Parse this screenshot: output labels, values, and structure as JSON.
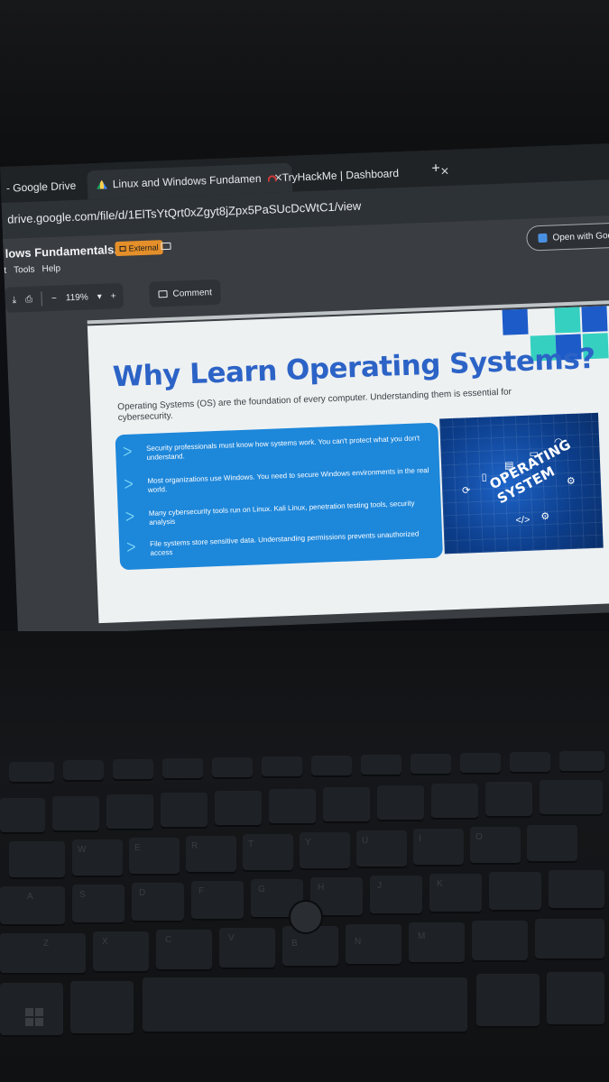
{
  "browser": {
    "tabs": [
      {
        "label": "- Google Drive",
        "close": "✕",
        "active": false
      },
      {
        "label": "Linux and Windows Fundamen",
        "close": "✕",
        "active": true
      },
      {
        "label": "TryHackMe | Dashboard",
        "close": "✕",
        "active": false
      }
    ],
    "new_tab": "+",
    "url": "drive.google.com/file/d/1ElTsYtQrt0xZgyt8jZpx5PaSUcDcWtC1/view"
  },
  "viewer": {
    "title": "lows Fundamentals.pdf",
    "badge": "External",
    "menu": [
      "t",
      "Tools",
      "Help"
    ],
    "open_with": "Open with Google",
    "zoom": "119%",
    "zoom_minus": "−",
    "zoom_plus": "+",
    "comment": "Comment"
  },
  "slide": {
    "heading": "Why Learn Operating Systems?",
    "intro": "Operating Systems (OS) are the foundation of every computer. Understanding them is essential for cybersecurity.",
    "bullets": [
      "Security professionals must know how systems work. You can't protect what you don't understand.",
      "Most organizations use Windows. You need to secure Windows environments in the real world.",
      "Many cybersecurity tools run on Linux. Kali Linux, penetration testing tools, security analysis",
      "File systems store sensitive data. Understanding permissions prevents unauthorized access"
    ],
    "image_label": "OPERATING SYSTEM"
  },
  "keyboard": {
    "letters": [
      "W",
      "E",
      "R",
      "T",
      "Y",
      "U",
      "I",
      "O",
      "A",
      "S",
      "D",
      "F",
      "G",
      "H",
      "J",
      "K",
      "Z",
      "X",
      "C",
      "V",
      "B",
      "N",
      "M"
    ]
  },
  "colors": {
    "accent_blue": "#2c63c6",
    "bullet_panel": "#1d87da",
    "badge_orange": "#e58f2a",
    "teal": "#35d0c0"
  }
}
